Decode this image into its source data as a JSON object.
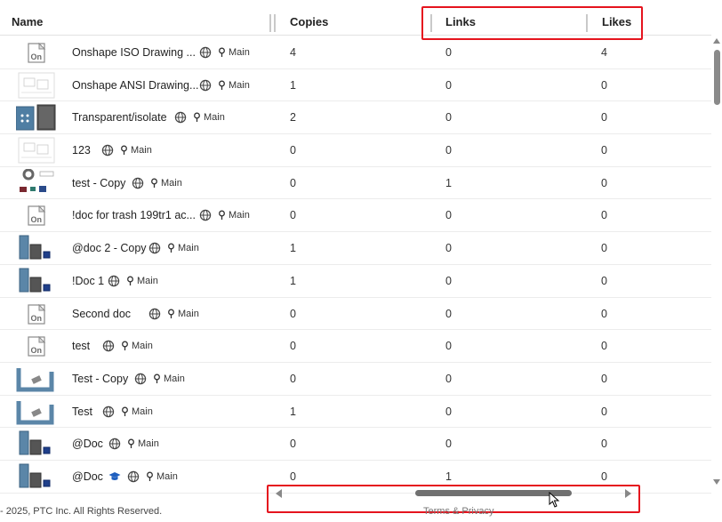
{
  "columns": {
    "name": "Name",
    "copies": "Copies",
    "links": "Links",
    "likes": "Likes"
  },
  "rows": [
    {
      "name": "Onshape ISO Drawing ...",
      "thumb": "onshape-doc-icon",
      "branch": "Main",
      "copies": "4",
      "links": "0",
      "likes": "4"
    },
    {
      "name": "Onshape ANSI Drawing...",
      "thumb": "drawing-sheet-thumbnail",
      "branch": "Main",
      "copies": "1",
      "links": "0",
      "likes": "0"
    },
    {
      "name": "Transparent/isolate",
      "thumb": "blue-cubes-thumbnail",
      "branch": "Main",
      "copies": "2",
      "links": "0",
      "likes": "0"
    },
    {
      "name": "123",
      "thumb": "drawing-sheet-thumbnail",
      "branch": "Main",
      "copies": "0",
      "links": "0",
      "likes": "0"
    },
    {
      "name": "test - Copy",
      "thumb": "parts-thumbnail",
      "branch": "Main",
      "copies": "0",
      "links": "1",
      "likes": "0"
    },
    {
      "name": "!doc for trash 199tr1 ac...",
      "thumb": "onshape-doc-icon",
      "branch": "Main",
      "copies": "0",
      "links": "0",
      "likes": "0"
    },
    {
      "name": "@doc 2 - Copy",
      "thumb": "blocks-thumbnail",
      "branch": "Main",
      "copies": "1",
      "links": "0",
      "likes": "0"
    },
    {
      "name": "!Doc 1",
      "thumb": "blocks-thumbnail",
      "branch": "Main",
      "copies": "1",
      "links": "0",
      "likes": "0"
    },
    {
      "name": "Second doc",
      "thumb": "onshape-doc-icon",
      "branch": "Main",
      "copies": "0",
      "links": "0",
      "likes": "0"
    },
    {
      "name": "test",
      "thumb": "onshape-doc-icon",
      "branch": "Main",
      "copies": "0",
      "links": "0",
      "likes": "0"
    },
    {
      "name": "Test - Copy",
      "thumb": "bracket-thumbnail",
      "branch": "Main",
      "copies": "0",
      "links": "0",
      "likes": "0"
    },
    {
      "name": "Test",
      "thumb": "bracket-thumbnail",
      "branch": "Main",
      "copies": "1",
      "links": "0",
      "likes": "0"
    },
    {
      "name": "@Doc",
      "thumb": "blocks-thumbnail",
      "branch": "Main",
      "copies": "0",
      "links": "0",
      "likes": "0"
    },
    {
      "name": "@Doc",
      "thumb": "blocks-thumbnail",
      "branch": "Main",
      "copies": "0",
      "links": "1",
      "likes": "0",
      "education_icon": true
    }
  ],
  "footer": {
    "copyright": "- 2025, PTC Inc. All Rights Reserved.",
    "link": "Terms & Privacy"
  },
  "icons": {
    "public": "globe-icon",
    "branch": "branch-pin-icon",
    "education": "graduation-cap-icon"
  },
  "colors": {
    "highlight": "#e5141e",
    "thumb_blue": "#5b86a8",
    "text": "#222222"
  }
}
